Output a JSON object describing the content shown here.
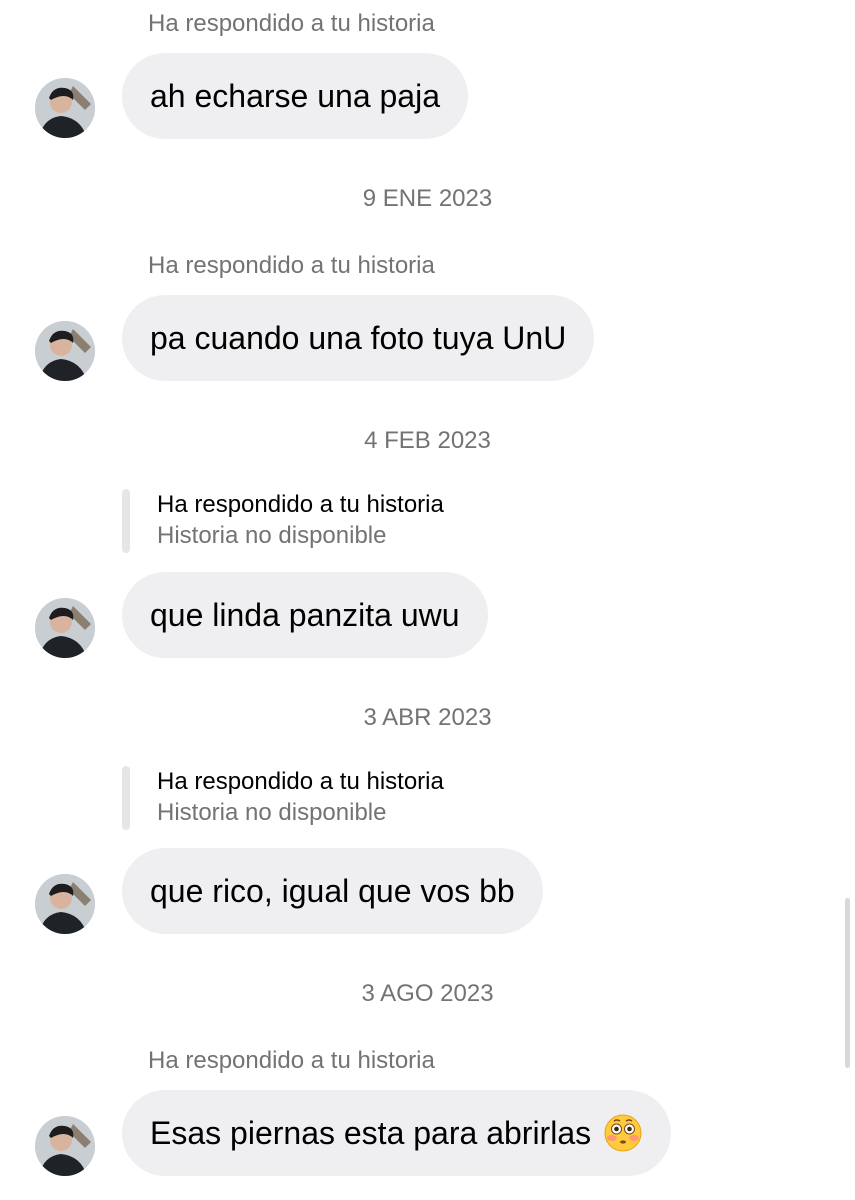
{
  "messages": [
    {
      "date": "",
      "reply_label": "Ha respondido a tu historia",
      "story_status": "",
      "text": "ah echarse una paja",
      "emoji": ""
    },
    {
      "date": "9 ENE 2023",
      "reply_label": "Ha respondido a tu historia",
      "story_status": "",
      "text": "pa cuando una foto tuya UnU",
      "emoji": ""
    },
    {
      "date": "4 FEB 2023",
      "reply_label": "Ha respondido a tu historia",
      "story_status": "Historia no disponible",
      "text": "que linda panzita uwu",
      "emoji": ""
    },
    {
      "date": "3 ABR 2023",
      "reply_label": "Ha respondido a tu historia",
      "story_status": "Historia no disponible",
      "text": "que rico, igual que vos bb",
      "emoji": ""
    },
    {
      "date": "3 AGO 2023",
      "reply_label": "Ha respondido a tu historia",
      "story_status": "",
      "text": "Esas piernas esta para abrirlas",
      "emoji": "flushed-face"
    }
  ],
  "colors": {
    "bubble_bg": "#efeff1",
    "meta_text": "#737373",
    "message_text": "#000000"
  }
}
